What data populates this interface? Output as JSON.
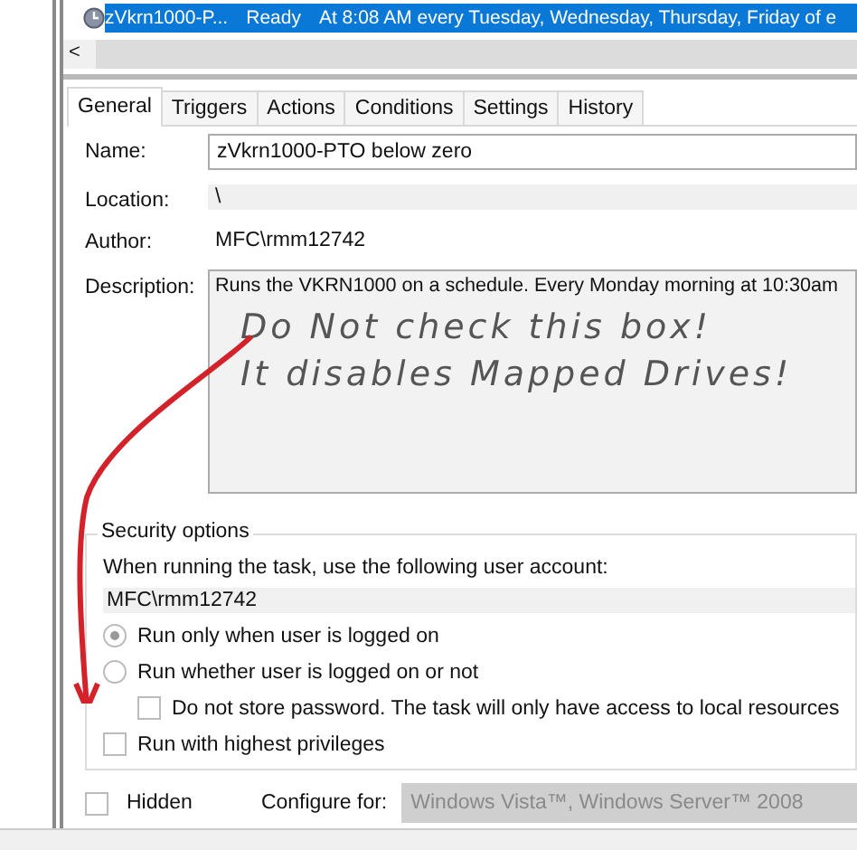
{
  "task_row": {
    "name": "zVkrn1000-P...",
    "status": "Ready",
    "trigger": "At 8:08 AM every Tuesday, Wednesday, Thursday, Friday of e",
    "selected": true
  },
  "scroll_left": "<",
  "tabs": [
    {
      "label": "General",
      "selected": true
    },
    {
      "label": "Triggers",
      "selected": false
    },
    {
      "label": "Actions",
      "selected": false
    },
    {
      "label": "Conditions",
      "selected": false
    },
    {
      "label": "Settings",
      "selected": false
    },
    {
      "label": "History",
      "selected": false
    }
  ],
  "general": {
    "name_label": "Name:",
    "name": "zVkrn1000-PTO below zero",
    "location_label": "Location:",
    "location": "\\",
    "author_label": "Author:",
    "author": "MFC\\rmm12742",
    "description_label": "Description:",
    "description": "Runs the VKRN1000 on a schedule.  Every Monday morning at 10:30am"
  },
  "annotation": {
    "lines": [
      "Do Not check this box!",
      "It disables Mapped Drives!"
    ]
  },
  "security": {
    "title": "Security options",
    "account_label": "When running the task, use the following user account:",
    "account": "MFC\\rmm12742",
    "options": [
      {
        "kind": "radio",
        "label": "Run only when user is logged on",
        "selected": true
      },
      {
        "kind": "radio",
        "label": "Run whether user is logged on or not",
        "selected": false,
        "children": [
          {
            "kind": "checkbox",
            "label": "Do not store password.  The task will only have access to local resources",
            "checked": false
          }
        ]
      },
      {
        "kind": "checkbox",
        "label": "Run with highest privileges",
        "checked": false
      }
    ]
  },
  "hidden": {
    "label": "Hidden",
    "checked": false
  },
  "configure": {
    "label": "Configure for:",
    "value": "Windows Vista™, Windows Server™ 2008",
    "disabled": true
  }
}
